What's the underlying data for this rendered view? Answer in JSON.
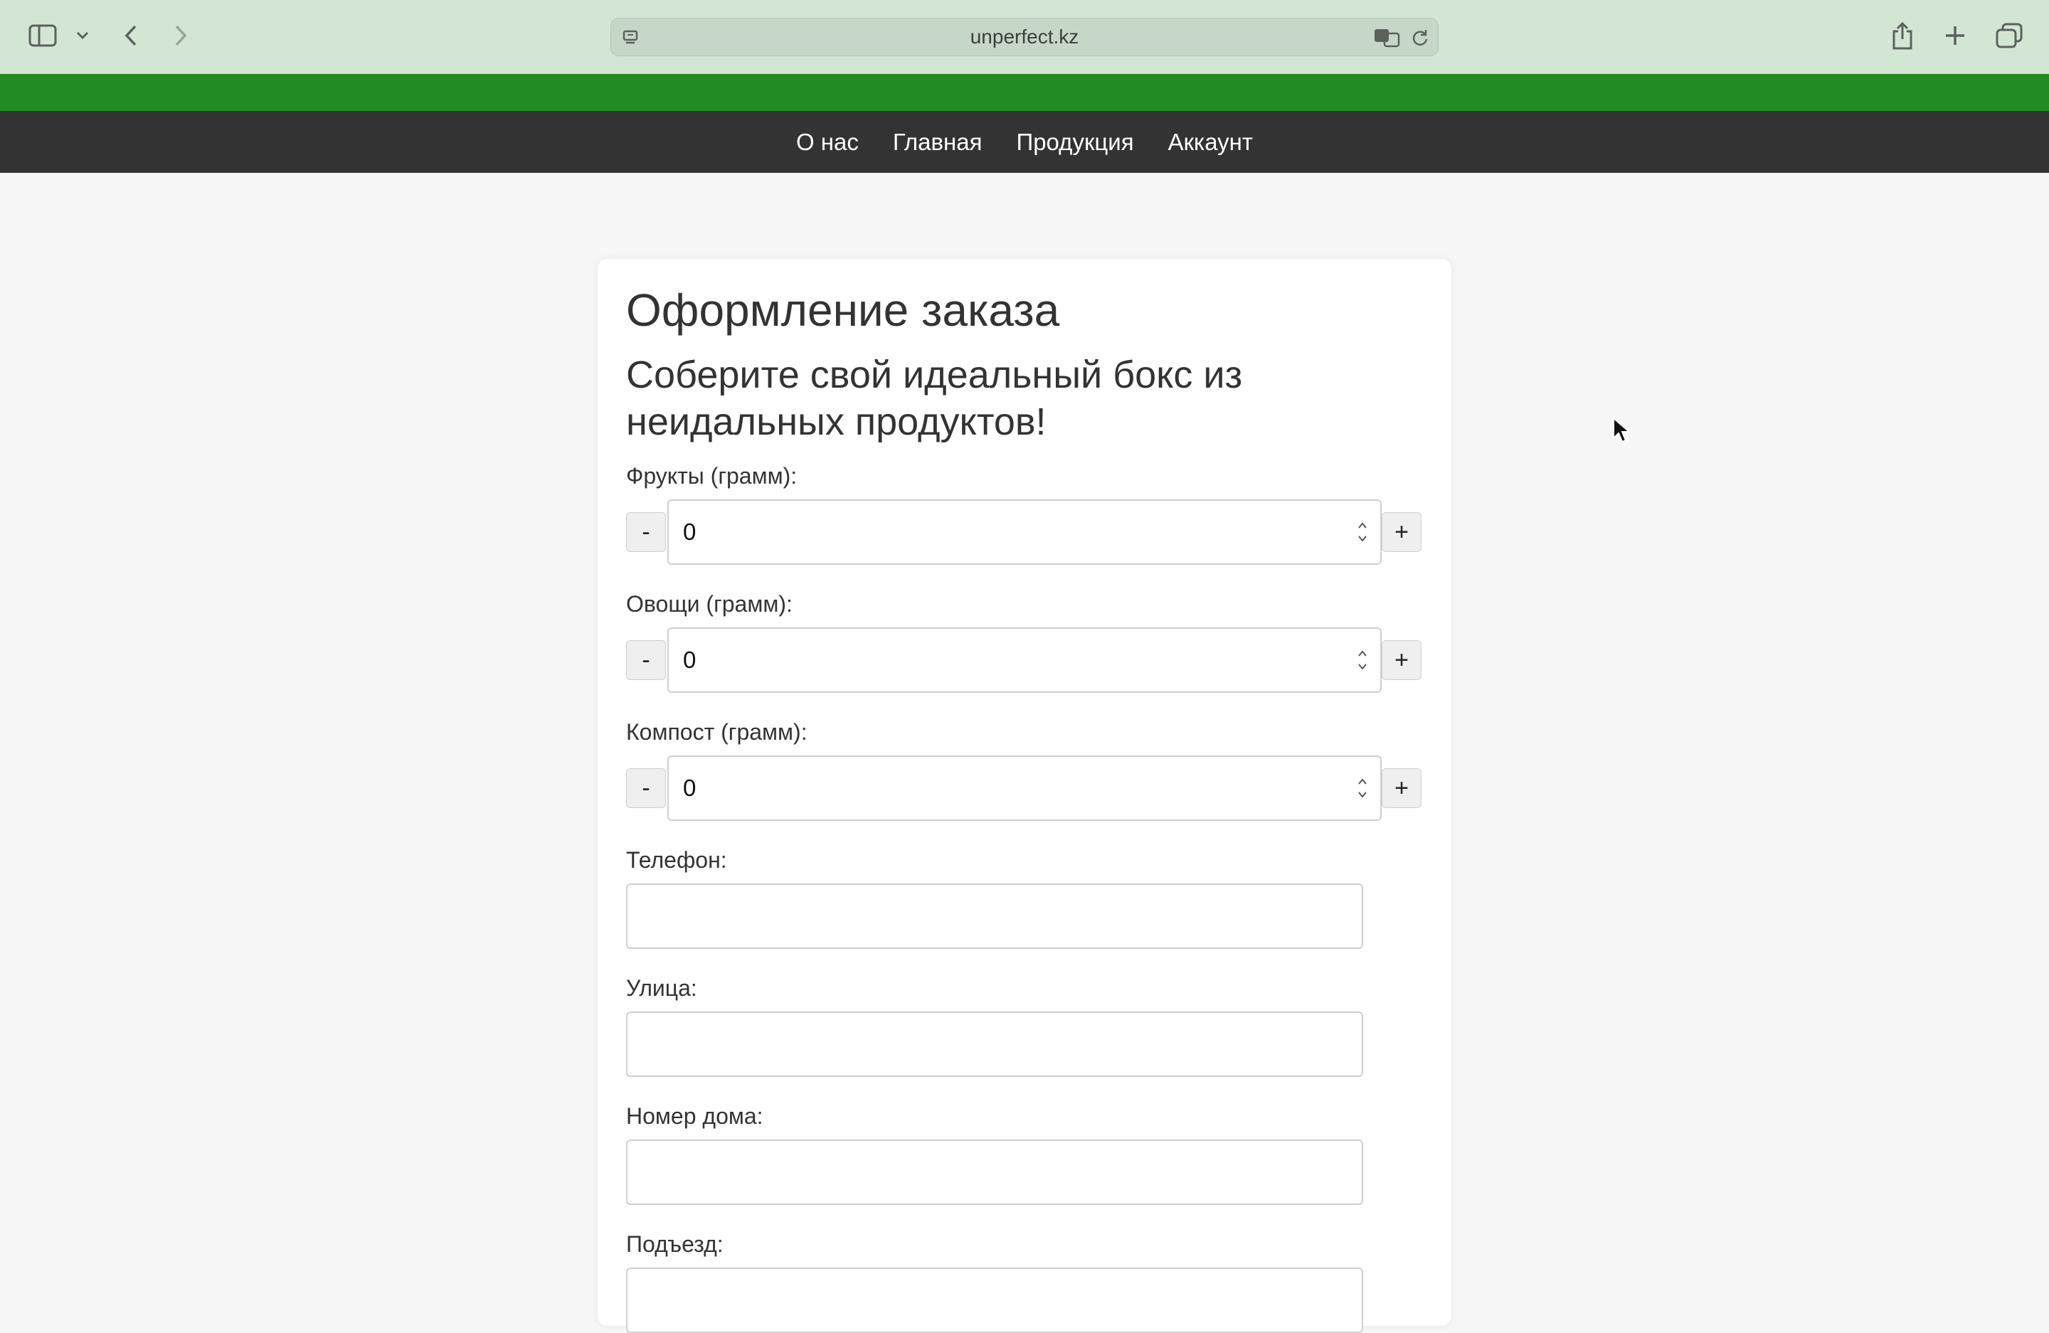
{
  "browser": {
    "url": "unperfect.kz"
  },
  "nav": {
    "items": [
      "О нас",
      "Главная",
      "Продукция",
      "Аккаунт"
    ]
  },
  "page": {
    "title": "Оформление заказа",
    "subtitle": "Соберите свой идеальный бокс из неидальных продуктов!"
  },
  "form": {
    "fruits": {
      "label": "Фрукты (грамм):",
      "value": "0"
    },
    "vegetables": {
      "label": "Овощи (грамм):",
      "value": "0"
    },
    "compost": {
      "label": "Компост (грамм):",
      "value": "0"
    },
    "minus_label": "-",
    "plus_label": "+",
    "phone_label": "Телефон:",
    "street_label": "Улица:",
    "house_label": "Номер дома:",
    "entrance_label": "Подъезд:"
  },
  "colors": {
    "chrome_bg": "#d3e6d4",
    "green_band": "#238b23",
    "nav_bg": "#333333"
  }
}
